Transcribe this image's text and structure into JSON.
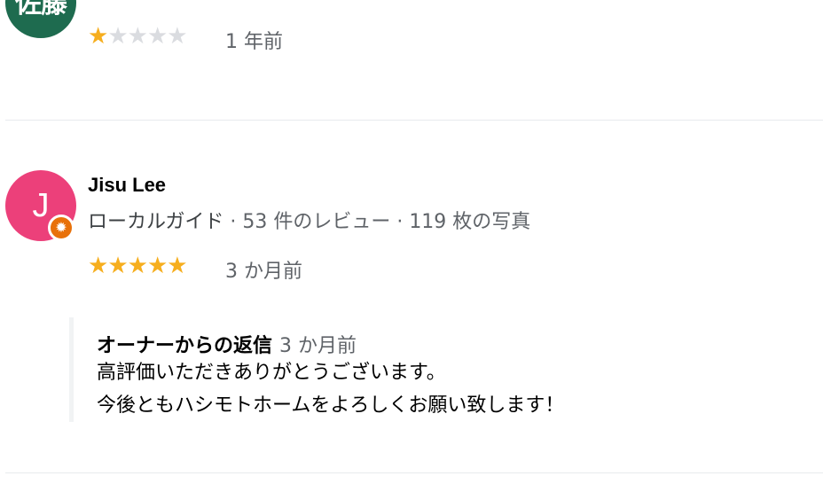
{
  "reviews": [
    {
      "avatar_text": "佐藤",
      "avatar_color": "#1e6b4f",
      "rating": 1,
      "max_rating": 5,
      "time": "1 年前"
    },
    {
      "avatar_text": "J",
      "avatar_color": "#ec407a",
      "name": "Jisu Lee",
      "badge": "ローカルガイド",
      "reviews_count": "53 件のレビュー",
      "photos_count": "119 枚の写真",
      "separator": " · ",
      "rating": 5,
      "max_rating": 5,
      "time": "3 か月前",
      "owner_reply": {
        "title": "オーナーからの返信",
        "time": "3 か月前",
        "lines": [
          "高評価いただきありがとうございます。",
          "今後ともハシモトホームをよろしくお願い致します！"
        ]
      }
    }
  ],
  "colors": {
    "star_on": "#f6ae1e",
    "star_off": "#dadce0",
    "local_guide_badge": "#e8710a"
  },
  "icons": {
    "star": "★",
    "local_guide": "local-guide-star-icon"
  }
}
